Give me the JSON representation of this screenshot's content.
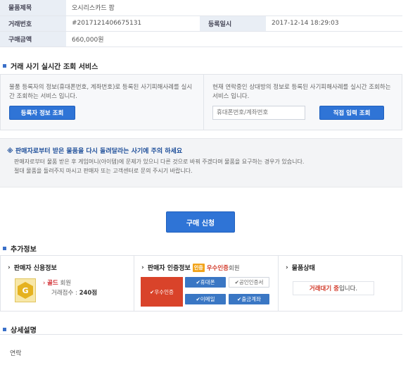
{
  "item_info": {
    "rows": [
      {
        "label": "물품제목",
        "value": "오시리스카드 팜"
      },
      {
        "label": "거래번호",
        "value": "#2017121406675131",
        "label2": "등록일시",
        "value2": "2017-12-14 18:29:03"
      },
      {
        "label": "구매금액",
        "value": "660,000원"
      }
    ]
  },
  "fraud_check": {
    "title": "거래 사기 실시간 조회 서비스",
    "left_desc": "물품 등록자의 정보(휴대폰번호, 계좌번호)로 등록된 사기피해사례를 실시간 조회하는 서비스 입니다.",
    "left_button": "등록자 정보 조회",
    "right_desc": "현재 연락중인 상대방의 정보로 등록된 사기피해사례를 실시간 조회하는 서비스 입니다.",
    "input_placeholder": "휴대폰번호/계좌번호",
    "right_button": "직접 입력 조회"
  },
  "warning": {
    "title": "※ 판매자로부터 받은 물품을 다시 돌려달라는 사기에 주의 하세요",
    "line1": "판매자로부터 물품 받은 후 게임머니(아이템)에 문제가 있으니 다른 것으로 바꿔 주겠다며 물품을 요구하는 경우가 있습니다.",
    "line2": "절대 물품을 돌려주지 마시고 판매자 또는 고객센터로 문의 주시기 바랍니다."
  },
  "buy_button": "구매 신청",
  "extra_info": {
    "title": "추가정보",
    "seller_credit": {
      "title": "판매자 신용정보",
      "badge_letter": "G",
      "grade_prefix": "골드",
      "grade_suffix": "회원",
      "score_label": "거래점수 :",
      "score_value": "240점"
    },
    "seller_cert": {
      "title": "판매자 인증정보",
      "badge_text": "인증",
      "level_text": "우수인증",
      "level_suffix": "회원",
      "main_cert": "✔우수인증",
      "pills": [
        {
          "label": "✔휴대폰",
          "active": true
        },
        {
          "label": "✔공인인증서",
          "active": false
        },
        {
          "label": "✔이메일",
          "active": true
        },
        {
          "label": "✔출금계좌",
          "active": true
        }
      ]
    },
    "item_status": {
      "title": "물품상태",
      "status_red": "거래대기 중",
      "status_suffix": "입니다."
    }
  },
  "detail": {
    "title": "상세설명",
    "text": "연락"
  },
  "colors": {
    "accent_blue": "#2f74d6",
    "cert_red": "#d9432a",
    "gold": "#e5b21f"
  }
}
